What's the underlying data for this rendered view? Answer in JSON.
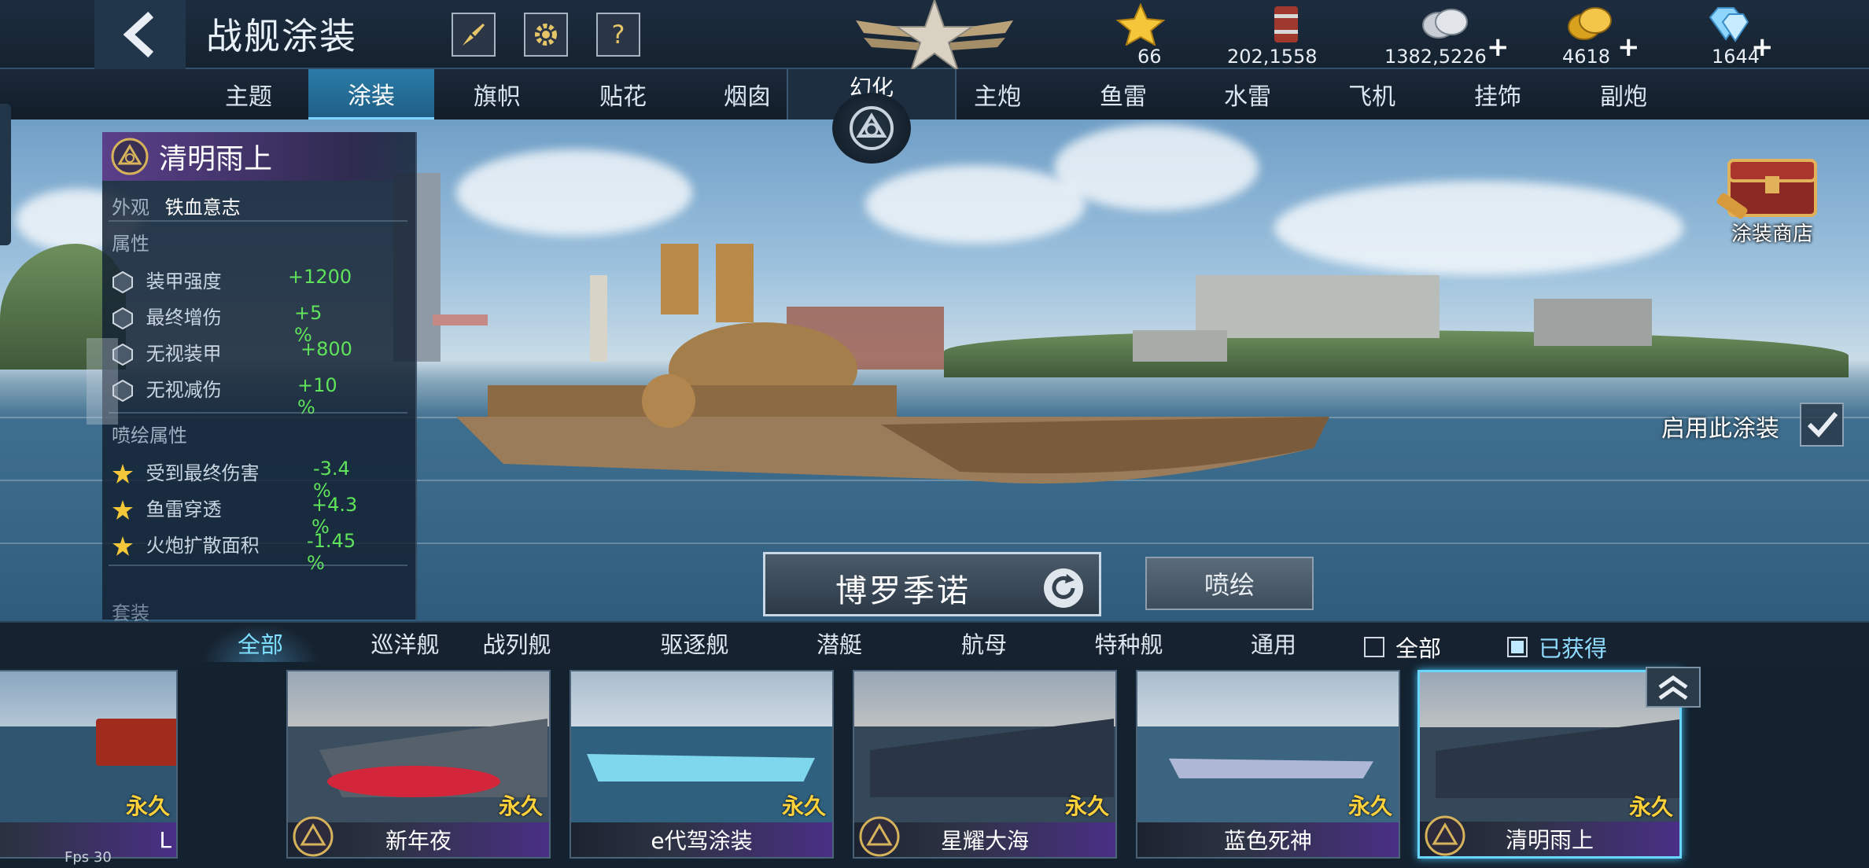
{
  "header": {
    "title": "战舰涂装",
    "back_icon": "back-arrow-icon",
    "buttons": [
      "brush-icon",
      "gear-icon",
      "help-icon"
    ],
    "help_label": "?"
  },
  "resources": [
    {
      "name": "star",
      "icon": "star-icon",
      "value": "66",
      "plus": false
    },
    {
      "name": "oil",
      "icon": "oil-barrel-icon",
      "value": "202,1558",
      "plus": false
    },
    {
      "name": "silver",
      "icon": "silver-coins-icon",
      "value": "1382,5226",
      "plus": true
    },
    {
      "name": "gold",
      "icon": "gold-coins-icon",
      "value": "4618",
      "plus": true
    },
    {
      "name": "diamond",
      "icon": "diamond-icon",
      "value": "1644",
      "plus": true
    }
  ],
  "plus_symbol": "+",
  "tabs": {
    "left": [
      "主题",
      "涂装",
      "旗帜",
      "贴花",
      "烟囱"
    ],
    "center": "幻化",
    "right": [
      "主炮",
      "鱼雷",
      "水雷",
      "飞机",
      "挂饰",
      "副炮"
    ],
    "active": "涂装"
  },
  "info_panel": {
    "name": "清明雨上",
    "appearance_label": "外观",
    "appearance_value": "铁血意志",
    "attributes_title": "属性",
    "attributes": [
      {
        "label": "装甲强度",
        "value": "+1200"
      },
      {
        "label": "最终增伤",
        "value": "+5 %"
      },
      {
        "label": "无视装甲",
        "value": "+800"
      },
      {
        "label": "无视减伤",
        "value": "+10 %"
      }
    ],
    "spray_title": "喷绘属性",
    "spray_attributes": [
      {
        "label": "受到最终伤害",
        "value": "-3.4 %"
      },
      {
        "label": "鱼雷穿透",
        "value": "+4.3 %"
      },
      {
        "label": "火炮扩散面积",
        "value": "-1.45 %"
      }
    ],
    "cutoff_text": "套装"
  },
  "shop": {
    "label": "涂装商店"
  },
  "enable": {
    "label": "启用此涂装",
    "checked": true
  },
  "ship": {
    "name": "博罗季诺"
  },
  "spray_button": "喷绘",
  "filter": {
    "tabs": [
      "全部",
      "巡洋舰",
      "战列舰",
      "驱逐舰",
      "潜艇",
      "航母",
      "特种舰",
      "通用"
    ],
    "active": "全部",
    "check_all": "全部",
    "check_all_on": false,
    "check_owned": "已获得",
    "check_owned_on": true
  },
  "cards": [
    {
      "name": "L",
      "perm": "永久",
      "icon": false
    },
    {
      "name": "新年夜",
      "perm": "永久",
      "icon": true
    },
    {
      "name": "e代驾涂装",
      "perm": "永久",
      "icon": false
    },
    {
      "name": "星耀大海",
      "perm": "永久",
      "icon": true
    },
    {
      "name": "蓝色死神",
      "perm": "永久",
      "icon": false
    },
    {
      "name": "清明雨上",
      "perm": "永久",
      "icon": true
    }
  ],
  "fps": "Fps 30",
  "colors": {
    "accent": "#2a7ca8",
    "positive": "#5fe35a",
    "permanent": "#ffd13b",
    "legend": "#4a2f86"
  }
}
